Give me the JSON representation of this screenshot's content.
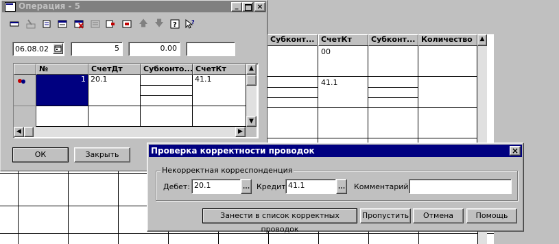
{
  "operation_window": {
    "title": "Операция - 5",
    "toolbar_icons": [
      "new-row-icon",
      "edit-row-icon",
      "copy-row-icon",
      "insert-row-icon",
      "delete-row-icon",
      "properties-icon",
      "move-icon",
      "journal-icon",
      "arrow-up-icon",
      "arrow-down-icon",
      "help-icon",
      "pointer-help-icon"
    ],
    "date": "06.08.02",
    "number": "5",
    "sum": "0.00",
    "extra": "",
    "grid_headers": [
      "№",
      "СчетДт",
      "Субконто...",
      "СчетКт"
    ],
    "rows": [
      {
        "num": "1",
        "debit": "20.1",
        "subconto": "",
        "credit": "41.1"
      }
    ],
    "ok_label": "ОК",
    "close_label": "Закрыть"
  },
  "background_grid": {
    "headers": [
      "Субконт...",
      "СчетКт",
      "Субконт...",
      "Количество"
    ],
    "cells": {
      "r0_schetkt": "00",
      "r1_schetkt": "41.1"
    }
  },
  "dialog": {
    "title": "Проверка корректности проводок",
    "group_label": "Некорректная корреспонденция",
    "debit_label": "Дебет:",
    "debit_value": "20.1",
    "credit_label": "Кредит:",
    "credit_value": "41.1",
    "comment_label": "Комментарий:",
    "comment_value": "",
    "btn_add": "Занести в список корректных проводок",
    "btn_skip": "Пропустить",
    "btn_cancel": "Отмена",
    "btn_help": "Помощь"
  }
}
